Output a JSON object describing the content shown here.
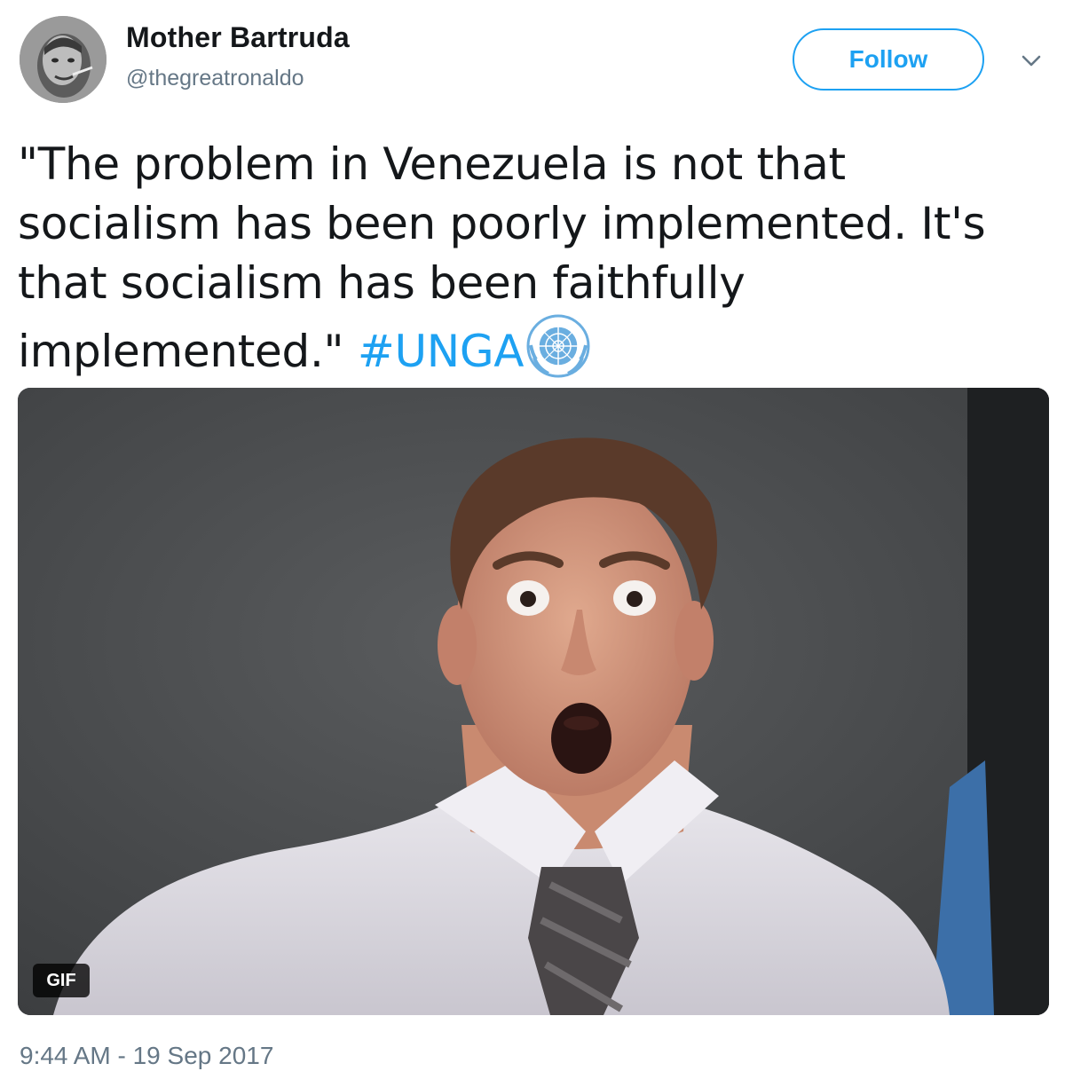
{
  "user": {
    "display_name": "Mother Bartruda",
    "handle": "@thegreatronaldo",
    "avatar_icon": "profile-photo"
  },
  "header": {
    "follow_label": "Follow",
    "more_icon": "chevron-down-icon"
  },
  "tweet": {
    "text": "\"The problem in Venezuela is not that socialism has been poorly implemented. It's that socialism has been faithfully implemented.\" ",
    "hashtag": "#UNGA",
    "emoji_icon": "united-nations-emblem"
  },
  "media": {
    "badge": "GIF",
    "description_icon": "animated-gif-surprised-man"
  },
  "footer": {
    "timestamp": "9:44 AM - 19 Sep 2017"
  },
  "colors": {
    "accent": "#1da1f2",
    "text": "#14171a",
    "muted": "#657786"
  }
}
